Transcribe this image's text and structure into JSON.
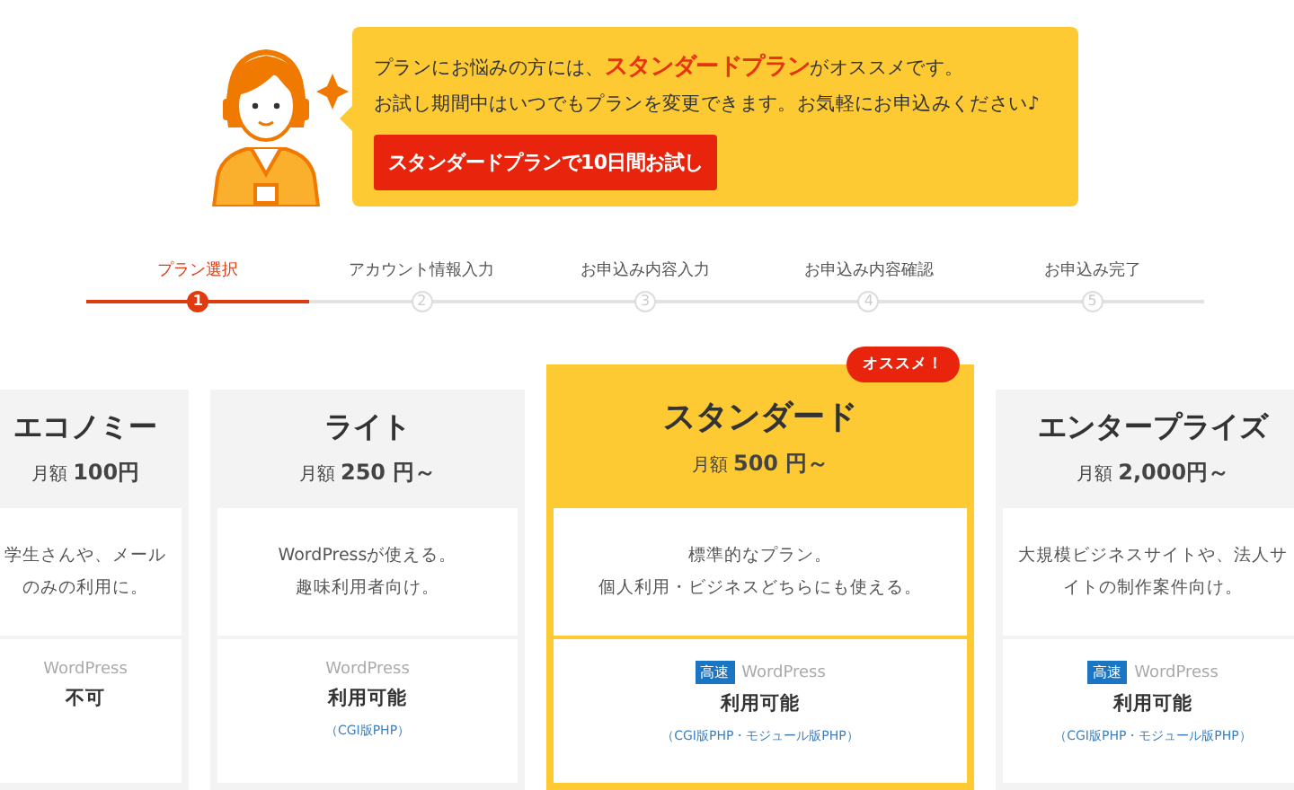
{
  "banner": {
    "message_before": "プランにお悩みの方には、",
    "message_highlight": "スタンダードプラン",
    "message_after": "がオススメです。",
    "message_line2": "お試し期間中はいつでもプランを変更できます。お気軽にお申込みください♪",
    "button": "スタンダードプランで10日間お試し"
  },
  "steps": [
    {
      "label": "プラン選択",
      "number": "1",
      "selected": true
    },
    {
      "label": "アカウント情報入力",
      "number": "2",
      "selected": false
    },
    {
      "label": "お申込み内容入力",
      "number": "3",
      "selected": false
    },
    {
      "label": "お申込み内容確認",
      "number": "4",
      "selected": false
    },
    {
      "label": "お申込み完了",
      "number": "5",
      "selected": false
    }
  ],
  "plans": [
    {
      "name": "エコノミー",
      "price": "月額 **100円**",
      "featured": false,
      "description_lines": [
        "学生さんや、メール",
        "のみの利用に。"
      ],
      "feature": {
        "label": "WordPress",
        "value": "不可"
      }
    },
    {
      "name": "ライト",
      "price": "月額 **250 円～**",
      "featured": false,
      "description_lines": [
        "WordPressが使える。",
        "趣味利用者向け。"
      ],
      "feature": {
        "label": "WordPress",
        "value": "利用可能",
        "note": "（CGI版PHP）"
      }
    },
    {
      "name": "スタンダード",
      "price": "月額 **500 円～**",
      "featured": true,
      "badge": "オススメ！",
      "description_lines": [
        "標準的なプラン。",
        "個人利用・ビジネスどちらにも使える。"
      ],
      "feature": {
        "tag": "高速",
        "label": "WordPress",
        "value": "利用可能",
        "note": "（CGI版PHP・モジュール版PHP）"
      }
    },
    {
      "name": "エンタープライズ",
      "price": "月額 **2,000円～**",
      "featured": false,
      "description_lines": [
        "大規模ビジネスサイトや、法人サ",
        "イトの制作案件向け。"
      ],
      "feature": {
        "tag": "高速",
        "label": "WordPress",
        "value": "利用可能",
        "note": "（CGI版PHP・モジュール版PHP）"
      }
    }
  ]
}
